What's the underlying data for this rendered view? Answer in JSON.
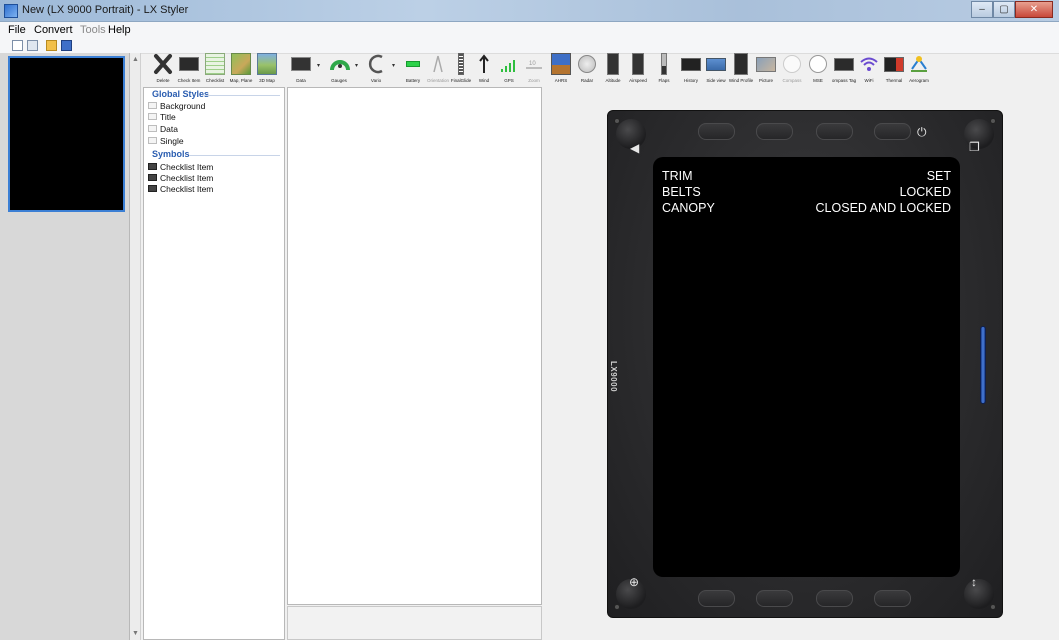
{
  "window": {
    "title": "New (LX 9000 Portrait) - LX Styler"
  },
  "menu": [
    {
      "label": "File",
      "enabled": true
    },
    {
      "label": "Convert",
      "enabled": true
    },
    {
      "label": "Tools",
      "enabled": false
    },
    {
      "label": "Help",
      "enabled": true
    }
  ],
  "toolbar": {
    "tools": [
      {
        "label": "Delete",
        "icon": "close-x-icon",
        "dim": false
      },
      {
        "label": "Check Item",
        "icon": "check-item-icon",
        "dim": false
      },
      {
        "label": "Checklist",
        "icon": "checklist-icon",
        "dim": false
      },
      {
        "label": "Map, Plane",
        "icon": "map-plane-icon",
        "dim": false
      },
      {
        "label": "3D Map",
        "icon": "3d-map-icon",
        "dim": false
      },
      {
        "label": "Data",
        "icon": "data-icon",
        "dim": false
      },
      {
        "label": "Gauges",
        "icon": "gauge-icon",
        "dim": false
      },
      {
        "label": "Vario",
        "icon": "vario-icon",
        "dim": false
      },
      {
        "label": "Battery",
        "icon": "battery-icon",
        "dim": false
      },
      {
        "label": "Orientation",
        "icon": "orientation-icon",
        "dim": true
      },
      {
        "label": "FinalGlide",
        "icon": "final-glide-icon",
        "dim": false
      },
      {
        "label": "Wind",
        "icon": "wind-arrow-icon",
        "dim": false
      },
      {
        "label": "GPS",
        "icon": "gps-signal-icon",
        "dim": false
      },
      {
        "label": "Zoom",
        "icon": "zoom-icon",
        "dim": true
      },
      {
        "label": "AHRS",
        "icon": "ahrs-icon",
        "dim": false
      },
      {
        "label": "Radar",
        "icon": "radar-icon",
        "dim": false
      },
      {
        "label": "Altitude",
        "icon": "altitude-icon",
        "dim": false
      },
      {
        "label": "Airspeed",
        "icon": "airspeed-icon",
        "dim": false
      },
      {
        "label": "Flaps",
        "icon": "flaps-icon",
        "dim": false
      },
      {
        "label": "History",
        "icon": "history-icon",
        "dim": false
      },
      {
        "label": "Side view",
        "icon": "side-view-icon",
        "dim": false
      },
      {
        "label": "Wind Profile",
        "icon": "wind-profile-icon",
        "dim": false
      },
      {
        "label": "Picture",
        "icon": "picture-icon",
        "dim": false
      },
      {
        "label": "Compass",
        "icon": "compass-icon",
        "dim": true
      },
      {
        "label": "MSE",
        "icon": "mse-icon",
        "dim": false
      },
      {
        "label": "ompass Tag",
        "icon": "compass-tag-icon",
        "dim": false
      },
      {
        "label": "WiFi",
        "icon": "wifi-icon",
        "dim": false
      },
      {
        "label": "Thermal",
        "icon": "thermal-icon",
        "dim": false
      },
      {
        "label": "Aerogram",
        "icon": "aerogram-icon",
        "dim": false
      }
    ]
  },
  "tree": {
    "global_styles": {
      "header": "Global Styles",
      "items": [
        "Background",
        "Title",
        "Data",
        "Single"
      ]
    },
    "symbols": {
      "header": "Symbols",
      "items": [
        "Checklist Item",
        "Checklist Item",
        "Checklist Item"
      ]
    }
  },
  "device": {
    "label": "LX9000",
    "checklist": [
      {
        "item": "TRIM",
        "value": "SET"
      },
      {
        "item": "BELTS",
        "value": "LOCKED"
      },
      {
        "item": "CANOPY",
        "value": "CLOSED AND LOCKED"
      }
    ],
    "accent_color": "#3a6fd8"
  }
}
